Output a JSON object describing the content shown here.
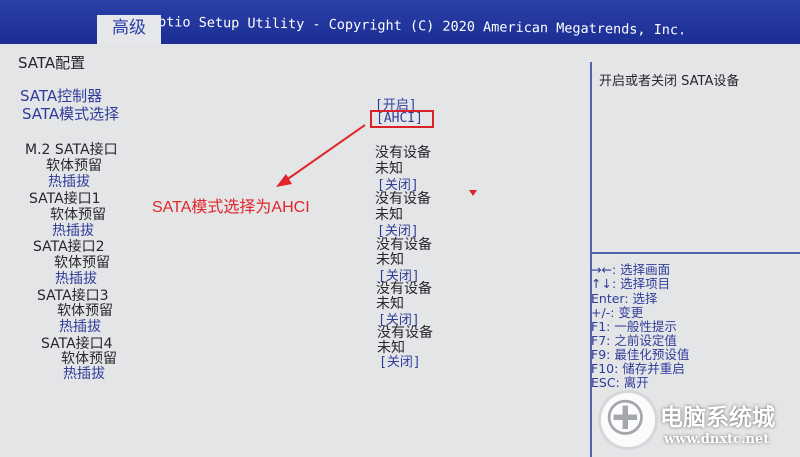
{
  "header": {
    "tab_label": "高级",
    "title": "Aptio Setup Utility - Copyright (C) 2020 American Megatrends, Inc."
  },
  "section_title": "SATA配置",
  "settings": {
    "sata_controller": {
      "label": "SATA控制器",
      "value": "[开启]"
    },
    "sata_mode": {
      "label": "SATA模式选择",
      "value": "[AHCI]"
    }
  },
  "ports": [
    {
      "name": "M.2 SATA接口",
      "status": "没有设备",
      "soft_reserve_label": "软体预留",
      "soft_reserve_value": "未知",
      "hotplug_label": "热插拔",
      "hotplug_value": "[关闭]"
    },
    {
      "name": "SATA接口1",
      "status": "没有设备",
      "soft_reserve_label": "软体预留",
      "soft_reserve_value": "未知",
      "hotplug_label": "热插拔",
      "hotplug_value": "[关闭]"
    },
    {
      "name": "SATA接口2",
      "status": "没有设备",
      "soft_reserve_label": "软体预留",
      "soft_reserve_value": "未知",
      "hotplug_label": "热插拔",
      "hotplug_value": "[关闭]"
    },
    {
      "name": "SATA接口3",
      "status": "没有设备",
      "soft_reserve_label": "软体预留",
      "soft_reserve_value": "未知",
      "hotplug_label": "热插拔",
      "hotplug_value": "[关闭]"
    },
    {
      "name": "SATA接口4",
      "status": "没有设备",
      "soft_reserve_label": "软体预留",
      "soft_reserve_value": "未知",
      "hotplug_label": "热插拔",
      "hotplug_value": "[关闭]"
    }
  ],
  "help_text": "开启或者关闭 SATA设备",
  "key_hints": [
    "→←: 选择画面",
    "↑↓: 选择项目",
    "Enter: 选择",
    "+/-: 变更",
    "F1: 一般性提示",
    "F7: 之前设定值",
    "F9: 最佳化预设值",
    "F10: 储存并重启",
    "ESC: 离开"
  ],
  "annotation": {
    "text": "SATA模式选择为AHCI",
    "color": "#e0262a"
  },
  "watermark": {
    "text": "电脑系统城",
    "url": "www.dnxtc.net"
  },
  "colors": {
    "header_bg": "#1c2e94",
    "panel_bg": "#e4e5e7",
    "selectable_text": "#2f3d9a",
    "static_text": "#27272c"
  }
}
